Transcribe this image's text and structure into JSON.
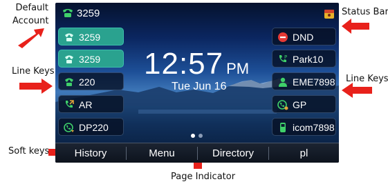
{
  "annotations": {
    "default_account": [
      "Default",
      "Account"
    ],
    "status_bar": "Status Bar",
    "line_keys_left": "Line Keys",
    "line_keys_right": "Line Keys",
    "soft_keys": "Soft keys",
    "page_indicator": "Page Indicator"
  },
  "colors": {
    "arrow": "#e8211b",
    "line_key_active": "#2aa28f",
    "icon_green": "#3fd06a",
    "dnd_red": "#e53935",
    "page_dot_active": "#ffffff",
    "page_dot_inactive": "#8a9bb5"
  },
  "phone": {
    "top_bar": {
      "account": "3259",
      "account_icon": "phone-handset-icon",
      "status_icon": "status-notification-icon"
    },
    "clock": {
      "time": "12:57",
      "ampm": "PM",
      "date": "Tue Jun 16"
    },
    "left_keys": [
      {
        "label": "3259",
        "icon": "line-registered-icon",
        "active": true
      },
      {
        "label": "3259",
        "icon": "line-registered-icon",
        "active": true
      },
      {
        "label": "220",
        "icon": "line-registered-icon",
        "active": false
      },
      {
        "label": "AR",
        "icon": "call-forward-icon",
        "active": false
      },
      {
        "label": "DP220",
        "icon": "directed-pickup-icon",
        "active": false
      }
    ],
    "right_keys": [
      {
        "label": "DND",
        "icon": "dnd-icon"
      },
      {
        "label": "Park10",
        "icon": "call-park-icon"
      },
      {
        "label": "EME7898",
        "icon": "contact-icon"
      },
      {
        "label": "GP",
        "icon": "group-pickup-icon"
      },
      {
        "label": "icom7898",
        "icon": "intercom-icon"
      }
    ],
    "page_indicator": {
      "pages": 2,
      "current": 1
    },
    "softkeys": [
      "History",
      "Menu",
      "Directory",
      "pl"
    ]
  }
}
